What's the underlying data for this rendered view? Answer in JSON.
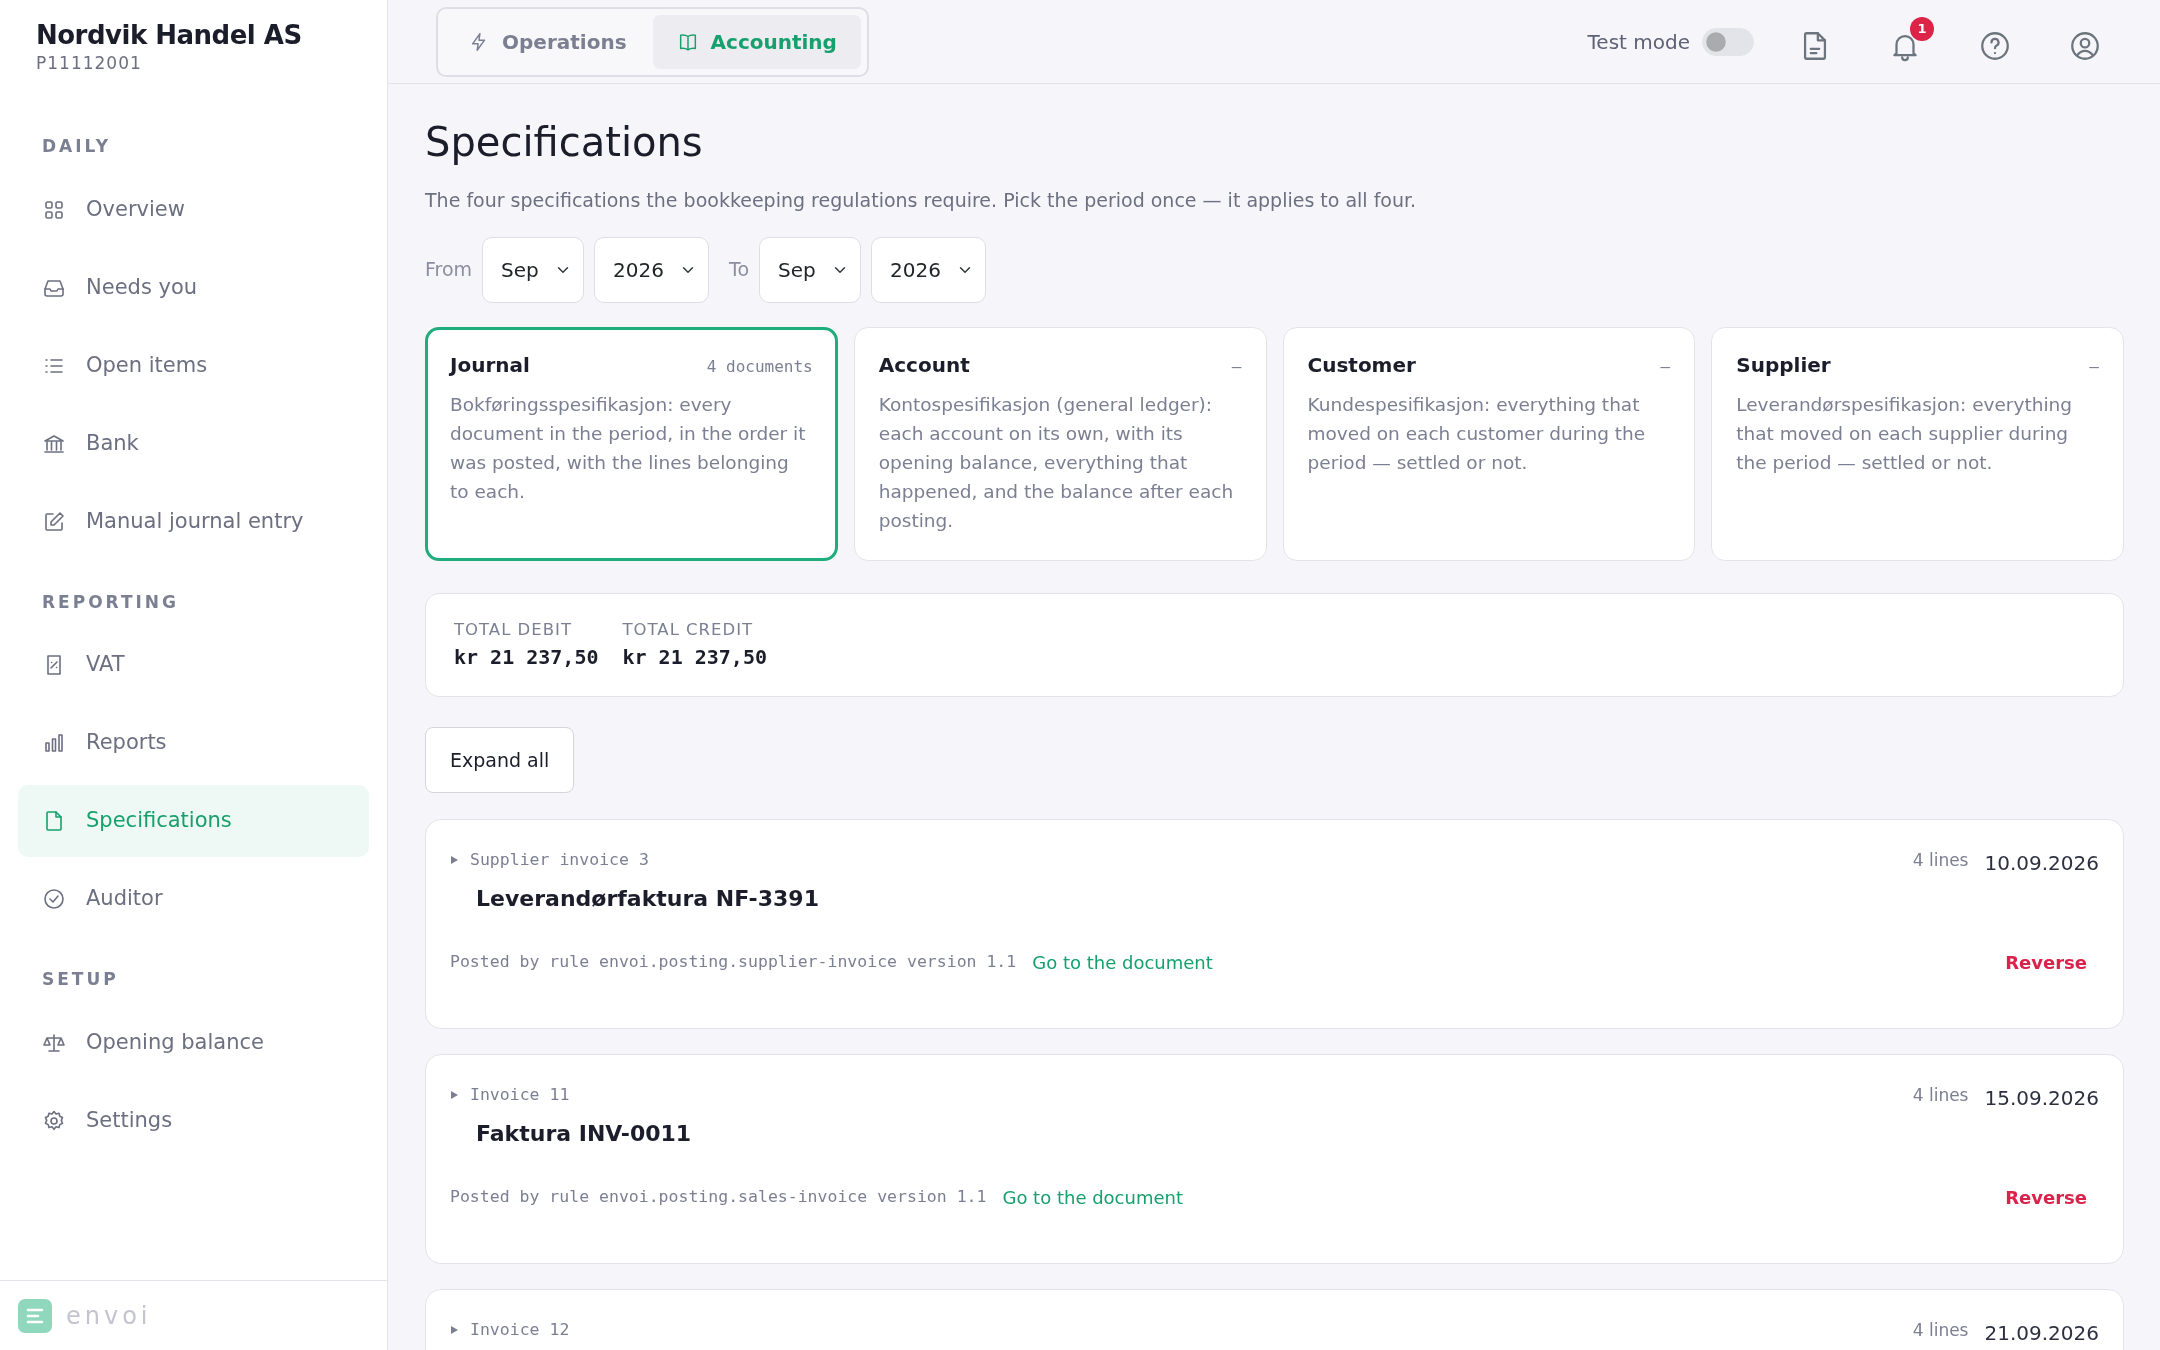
{
  "sidebar": {
    "company": "Nordvik Handel AS",
    "org_number": "P11112001",
    "sections": [
      {
        "title": "DAILY",
        "items": [
          {
            "label": "Overview",
            "selected": false
          },
          {
            "label": "Needs you",
            "selected": false
          },
          {
            "label": "Open items",
            "selected": false
          },
          {
            "label": "Bank",
            "selected": false
          },
          {
            "label": "Manual journal entry",
            "selected": false
          }
        ]
      },
      {
        "title": "REPORTING",
        "items": [
          {
            "label": "VAT",
            "selected": false
          },
          {
            "label": "Reports",
            "selected": false
          },
          {
            "label": "Specifications",
            "selected": true
          },
          {
            "label": "Auditor",
            "selected": false
          }
        ]
      },
      {
        "title": "SETUP",
        "items": [
          {
            "label": "Opening balance",
            "selected": false
          },
          {
            "label": "Settings",
            "selected": false
          }
        ]
      }
    ],
    "brand": "envoi"
  },
  "topbar": {
    "tabs": [
      {
        "label": "Operations",
        "selected": false
      },
      {
        "label": "Accounting",
        "selected": true
      }
    ],
    "test_mode": {
      "label": "Test mode",
      "on": false
    },
    "notification_count": "1"
  },
  "page": {
    "title": "Specifications",
    "description": "The four specifications the bookkeeping regulations require. Pick the period once — it applies to all four.",
    "period": {
      "from_label": "From",
      "from_month": "Sep",
      "from_year": "2026",
      "to_label": "To",
      "to_month": "Sep",
      "to_year": "2026"
    }
  },
  "spec_cards": [
    {
      "title": "Journal",
      "meta": "4 documents",
      "description": "Bokføringsspesifikasjon: every document in the period, in the order it was posted, with the lines belonging to each.",
      "selected": true
    },
    {
      "title": "Account",
      "meta": "–",
      "description": "Kontospesifikasjon (general ledger): each account on its own, with its opening balance, everything that happened, and the balance after each posting.",
      "selected": false
    },
    {
      "title": "Customer",
      "meta": "–",
      "description": "Kundespesifikasjon: everything that moved on each customer during the period — settled or not.",
      "selected": false
    },
    {
      "title": "Supplier",
      "meta": "–",
      "description": "Leverandørspesifikasjon: everything that moved on each supplier during the period — settled or not.",
      "selected": false
    }
  ],
  "totals": [
    {
      "label": "TOTAL DEBIT",
      "value": "kr 21 237,50"
    },
    {
      "label": "TOTAL CREDIT",
      "value": "kr 21 237,50"
    }
  ],
  "expand_button": "Expand all",
  "documents": [
    {
      "type_label": "Supplier invoice 3",
      "title": "Leverandørfaktura NF-3391",
      "lines": "4 lines",
      "date": "10.09.2026",
      "rule_text": "Posted by rule envoi.posting.supplier-invoice version 1.1",
      "link": "Go to the document",
      "action": "Reverse"
    },
    {
      "type_label": "Invoice 11",
      "title": "Faktura INV-0011",
      "lines": "4 lines",
      "date": "15.09.2026",
      "rule_text": "Posted by rule envoi.posting.sales-invoice version 1.1",
      "link": "Go to the document",
      "action": "Reverse"
    },
    {
      "type_label": "Invoice 12",
      "lines": "4 lines",
      "date": "21.09.2026"
    }
  ]
}
